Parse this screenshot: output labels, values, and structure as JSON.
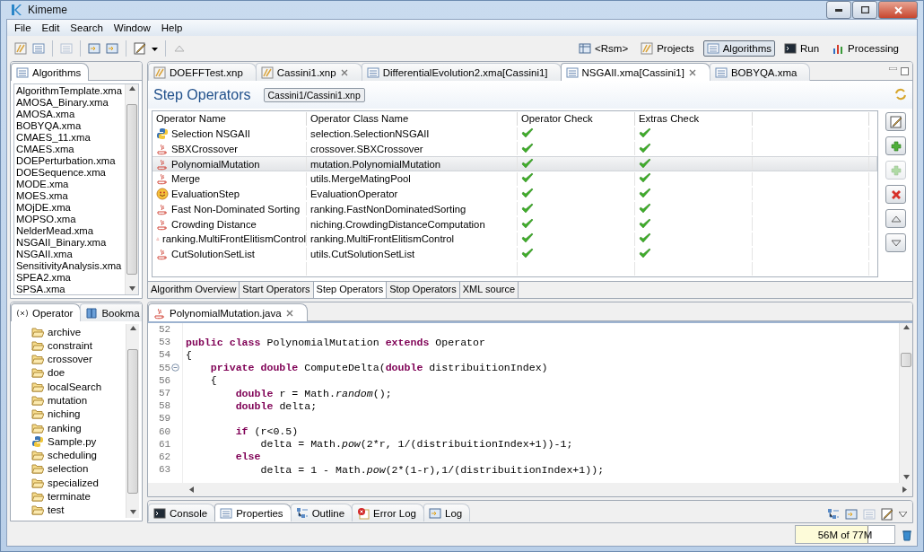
{
  "window": {
    "title": "Kimeme"
  },
  "menu": [
    "File",
    "Edit",
    "Search",
    "Window",
    "Help"
  ],
  "perspectives": [
    {
      "label": "<Rsm>",
      "kind": "table",
      "selected": false
    },
    {
      "label": "Projects",
      "kind": "project",
      "selected": false
    },
    {
      "label": "Algorithms",
      "kind": "list",
      "selected": true
    },
    {
      "label": "Run",
      "kind": "console",
      "selected": false
    },
    {
      "label": "Processing",
      "kind": "chart",
      "selected": false
    }
  ],
  "algorithms_view": {
    "title": "Algorithms",
    "items": [
      "AlgorithmTemplate.xma",
      "AMOSA_Binary.xma",
      "AMOSA.xma",
      "BOBYQA.xma",
      "CMAES_11.xma",
      "CMAES.xma",
      "DOEPerturbation.xma",
      "DOESequence.xma",
      "MODE.xma",
      "MOES.xma",
      "MOjDE.xma",
      "MOPSO.xma",
      "NelderMead.xma",
      "NSGAII_Binary.xma",
      "NSGAII.xma",
      "SensitivityAnalysis.xma",
      "SPEA2.xma",
      "SPSA.xma"
    ]
  },
  "operator_view": {
    "tabs": [
      {
        "label": "Operator",
        "kind": "variable",
        "selected": true
      },
      {
        "label": "Bookma",
        "kind": "book",
        "selected": false
      }
    ],
    "items": [
      {
        "label": "archive",
        "kind": "folder"
      },
      {
        "label": "constraint",
        "kind": "folder"
      },
      {
        "label": "crossover",
        "kind": "folder"
      },
      {
        "label": "doe",
        "kind": "folder"
      },
      {
        "label": "localSearch",
        "kind": "folder"
      },
      {
        "label": "mutation",
        "kind": "folder"
      },
      {
        "label": "niching",
        "kind": "folder"
      },
      {
        "label": "ranking",
        "kind": "folder"
      },
      {
        "label": "Sample.py",
        "kind": "python"
      },
      {
        "label": "scheduling",
        "kind": "folder"
      },
      {
        "label": "selection",
        "kind": "folder"
      },
      {
        "label": "specialized",
        "kind": "folder"
      },
      {
        "label": "terminate",
        "kind": "folder"
      },
      {
        "label": "test",
        "kind": "folder"
      }
    ]
  },
  "editor_tabs": [
    {
      "label": "DOEFFTest.xnp",
      "kind": "project",
      "selected": false,
      "closable": false
    },
    {
      "label": "Cassini1.xnp",
      "kind": "project",
      "selected": false,
      "closable": true
    },
    {
      "label": "DifferentialEvolution2.xma[Cassini1]",
      "kind": "list",
      "selected": false,
      "closable": false
    },
    {
      "label": "NSGAII.xma[Cassini1]",
      "kind": "list",
      "selected": true,
      "closable": true
    },
    {
      "label": "BOBYQA.xma",
      "kind": "list",
      "selected": false,
      "closable": false
    }
  ],
  "form": {
    "title": "Step Operators",
    "breadcrumb": "Cassini1/Cassini1.xnp",
    "table": {
      "columns": [
        "Operator Name",
        "Operator Class Name",
        "Operator Check",
        "Extras Check"
      ],
      "rows": [
        {
          "kind": "python",
          "name": "Selection NSGAII",
          "class_name": "selection.SelectionNSGAII",
          "operator_check": true,
          "extras_check": true,
          "selected": false
        },
        {
          "kind": "java",
          "name": "SBXCrossover",
          "class_name": "crossover.SBXCrossover",
          "operator_check": true,
          "extras_check": true,
          "selected": false
        },
        {
          "kind": "java",
          "name": "PolynomialMutation",
          "class_name": "mutation.PolynomialMutation",
          "operator_check": true,
          "extras_check": true,
          "selected": true
        },
        {
          "kind": "java",
          "name": "Merge",
          "class_name": "utils.MergeMatingPool",
          "operator_check": true,
          "extras_check": true,
          "selected": false
        },
        {
          "kind": "smiley",
          "name": "EvaluationStep",
          "class_name": "EvaluationOperator",
          "operator_check": true,
          "extras_check": true,
          "selected": false
        },
        {
          "kind": "java",
          "name": "Fast Non-Dominated Sorting",
          "class_name": "ranking.FastNonDominatedSorting",
          "operator_check": true,
          "extras_check": true,
          "selected": false
        },
        {
          "kind": "java",
          "name": "Crowding Distance",
          "class_name": "niching.CrowdingDistanceComputation",
          "operator_check": true,
          "extras_check": true,
          "selected": false
        },
        {
          "kind": "java",
          "name": "ranking.MultiFrontElitismControl",
          "class_name": "ranking.MultiFrontElitismControl",
          "operator_check": true,
          "extras_check": true,
          "selected": false
        },
        {
          "kind": "java",
          "name": "CutSolutionSetList",
          "class_name": "utils.CutSolutionSetList",
          "operator_check": true,
          "extras_check": true,
          "selected": false
        }
      ]
    },
    "side_buttons": [
      {
        "kind": "edit",
        "disabled": false
      },
      {
        "kind": "add",
        "disabled": false
      },
      {
        "kind": "add",
        "disabled": true
      },
      {
        "kind": "delete",
        "disabled": false
      },
      {
        "kind": "up",
        "disabled": false
      },
      {
        "kind": "down",
        "disabled": false
      }
    ],
    "page_tabs": [
      {
        "label": "Algorithm Overview",
        "selected": false
      },
      {
        "label": "Start Operators",
        "selected": false
      },
      {
        "label": "Step Operators",
        "selected": true
      },
      {
        "label": "Stop Operators",
        "selected": false
      },
      {
        "label": "XML source",
        "selected": false
      }
    ]
  },
  "code_editor": {
    "tab": "PolynomialMutation.java",
    "lines": [
      {
        "number": "52"
      },
      {
        "number": "53",
        "segments": [
          {
            "kind": "keyword",
            "text": "public class "
          },
          {
            "kind": "plain",
            "text": "PolynomialMutation "
          },
          {
            "kind": "keyword",
            "text": "extends "
          },
          {
            "kind": "plain",
            "text": "Operator"
          }
        ]
      },
      {
        "number": "54",
        "segments": [
          {
            "kind": "plain",
            "text": "{"
          }
        ]
      },
      {
        "number": "55",
        "foldable": true,
        "segments": [
          {
            "kind": "keyword",
            "text": "    private double "
          },
          {
            "kind": "plain",
            "text": "ComputeDelta("
          },
          {
            "kind": "keyword",
            "text": "double "
          },
          {
            "kind": "plain",
            "text": "distribuitionIndex)"
          }
        ]
      },
      {
        "number": "56",
        "segments": [
          {
            "kind": "plain",
            "text": "    {"
          }
        ]
      },
      {
        "number": "57",
        "segments": [
          {
            "kind": "keyword",
            "text": "        double "
          },
          {
            "kind": "plain",
            "text": "r = Math."
          },
          {
            "kind": "italic",
            "text": "random"
          },
          {
            "kind": "plain",
            "text": "();"
          }
        ]
      },
      {
        "number": "58",
        "segments": [
          {
            "kind": "keyword",
            "text": "        double "
          },
          {
            "kind": "plain",
            "text": "delta;"
          }
        ]
      },
      {
        "number": "59"
      },
      {
        "number": "60",
        "segments": [
          {
            "kind": "keyword",
            "text": "        if "
          },
          {
            "kind": "plain",
            "text": "(r<0.5)"
          }
        ]
      },
      {
        "number": "61",
        "segments": [
          {
            "kind": "plain",
            "text": "            delta = Math."
          },
          {
            "kind": "italic",
            "text": "pow"
          },
          {
            "kind": "plain",
            "text": "(2*r, 1/(distribuitionIndex+1))-1;"
          }
        ]
      },
      {
        "number": "62",
        "segments": [
          {
            "kind": "keyword",
            "text": "        else"
          }
        ]
      },
      {
        "number": "63",
        "segments": [
          {
            "kind": "plain",
            "text": "            delta = 1 - Math."
          },
          {
            "kind": "italic",
            "text": "pow"
          },
          {
            "kind": "plain",
            "text": "(2*(1-r),1/(distribuitionIndex+1));"
          }
        ]
      }
    ]
  },
  "bottom_tabs": [
    {
      "label": "Console",
      "kind": "console",
      "selected": false
    },
    {
      "label": "Properties",
      "kind": "list",
      "selected": true
    },
    {
      "label": "Outline",
      "kind": "outline",
      "selected": false
    },
    {
      "label": "Error Log",
      "kind": "error",
      "selected": false
    },
    {
      "label": "Log",
      "kind": "log",
      "selected": false
    }
  ],
  "status_bar": {
    "memory": "56M of 77M",
    "level": 0.73
  }
}
